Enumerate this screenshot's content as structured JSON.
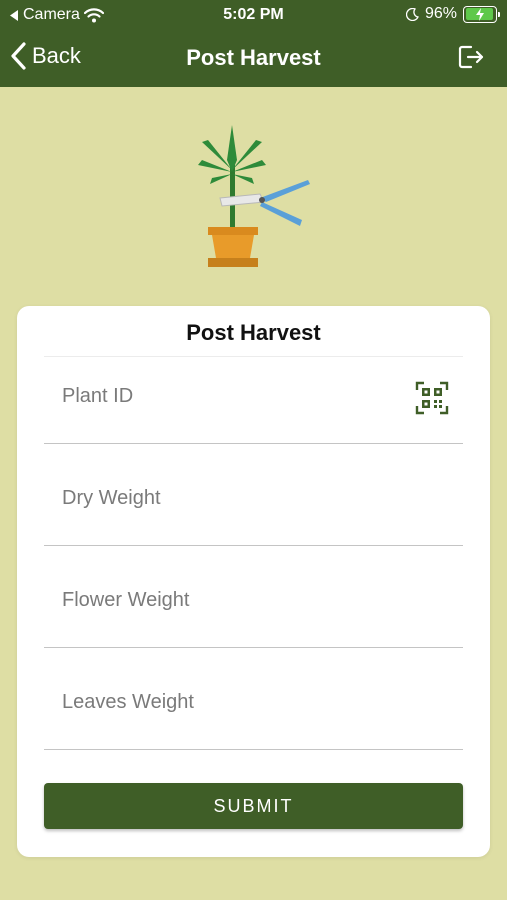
{
  "status_bar": {
    "back_app": "Camera",
    "time": "5:02 PM",
    "battery_percent": "96%",
    "battery_level": 0.96,
    "icons": [
      "back-triangle-icon",
      "wifi-icon",
      "moon-icon",
      "battery-charging-icon"
    ]
  },
  "nav": {
    "back_label": "Back",
    "title": "Post Harvest",
    "back_icon": "chevron-left-icon",
    "logout_icon": "logout-icon"
  },
  "illustration": {
    "icon": "plant-pruning-icon"
  },
  "form": {
    "title": "Post Harvest",
    "fields": [
      {
        "placeholder": "Plant ID",
        "value": "",
        "icon": "qr-code-icon"
      },
      {
        "placeholder": "Dry Weight",
        "value": ""
      },
      {
        "placeholder": "Flower Weight",
        "value": ""
      },
      {
        "placeholder": "Leaves Weight",
        "value": ""
      }
    ],
    "submit_label": "SUBMIT"
  },
  "colors": {
    "primary": "#3f5e27",
    "background": "#dedea4",
    "card": "#ffffff",
    "qr_icon": "#3f5e27"
  }
}
